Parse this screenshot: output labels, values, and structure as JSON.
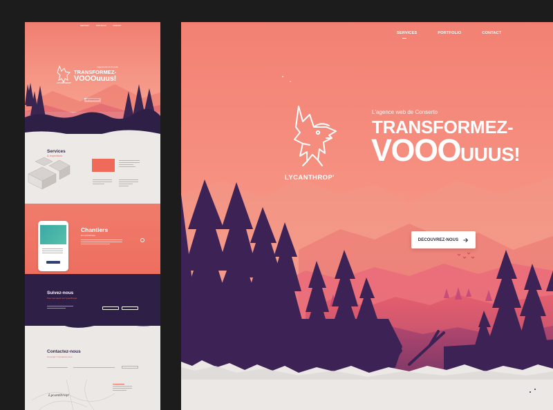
{
  "thumbnail": {
    "nav": [
      "SERVICES",
      "PORTFOLIO",
      "CONTACT"
    ],
    "hero_title_line1": "TRANSFORMEZ-",
    "hero_title_line2": "VOOOuuus!",
    "hero_tag": "L'agence web de Conserto",
    "cta": "DECOUVREZ-NOUS",
    "services_title": "Services",
    "services_sub": "& expertises",
    "chantiers_title": "Chantiers",
    "chantiers_sub": "En Lycanthrope",
    "suivez_title": "Suivez-nous",
    "suivez_sub": "Pour tout savoir sur Lycanthrope",
    "contact_title": "Contactez-nous",
    "contact_sub": "Un projet ? Contactez-nous",
    "map_label": "Lycanthrop'"
  },
  "hero": {
    "nav": [
      {
        "label": "SERVICES",
        "active": true
      },
      {
        "label": "PORTFOLIO",
        "active": false
      },
      {
        "label": "CONTACT",
        "active": false
      }
    ],
    "logo_text": "LYCANTHROP'",
    "tagline": "L'agence web de Conserto",
    "title_line1": "TRANSFORMEZ-",
    "title_line2_big": "VOOO",
    "title_line2_small": "UUUS!",
    "cta_label": "DECOUVREZ-NOUS",
    "cta_icon": "arrow-right-icon"
  },
  "colors": {
    "background": "#1c1c1c",
    "coral": "#f28173",
    "purple": "#2d1f46",
    "snow": "#ebe8e6"
  }
}
